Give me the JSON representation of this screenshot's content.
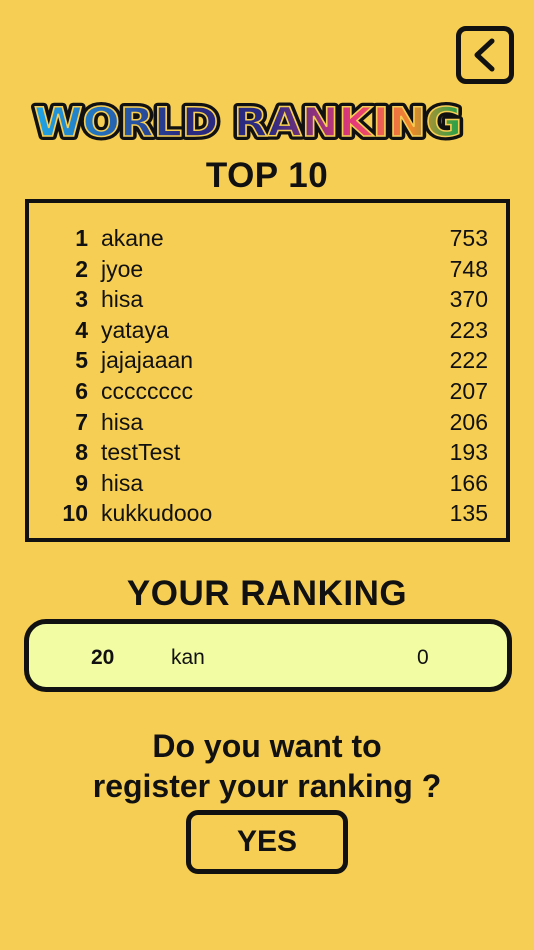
{
  "header": {
    "title": "WORLD RANKING",
    "title_colors": [
      "#1fa6e8",
      "#2a2a80",
      "#e83a7a",
      "#f08a2a",
      "#16a34a"
    ],
    "back_icon": "chevron-left-icon"
  },
  "top10": {
    "heading": "TOP 10",
    "rows": [
      {
        "rank": "1",
        "name": "akane",
        "score": "753"
      },
      {
        "rank": "2",
        "name": "jyoe",
        "score": "748"
      },
      {
        "rank": "3",
        "name": "hisa",
        "score": "370"
      },
      {
        "rank": "4",
        "name": "yataya",
        "score": "223"
      },
      {
        "rank": "5",
        "name": "jajajaaan",
        "score": "222"
      },
      {
        "rank": "6",
        "name": "cccccccc",
        "score": "207"
      },
      {
        "rank": "7",
        "name": "hisa",
        "score": "206"
      },
      {
        "rank": "8",
        "name": "testTest",
        "score": "193"
      },
      {
        "rank": "9",
        "name": "hisa",
        "score": "166"
      },
      {
        "rank": "10",
        "name": "kukkudooo",
        "score": "135"
      }
    ]
  },
  "your_ranking": {
    "heading": "YOUR RANKING",
    "rank": "20",
    "name": "kan",
    "score": "0",
    "background": "#f1fca3"
  },
  "register": {
    "question_line1": "Do you want to",
    "question_line2": "register your ranking ?",
    "yes_label": "YES"
  },
  "colors": {
    "background": "#f6ce53",
    "ink": "#111111"
  }
}
